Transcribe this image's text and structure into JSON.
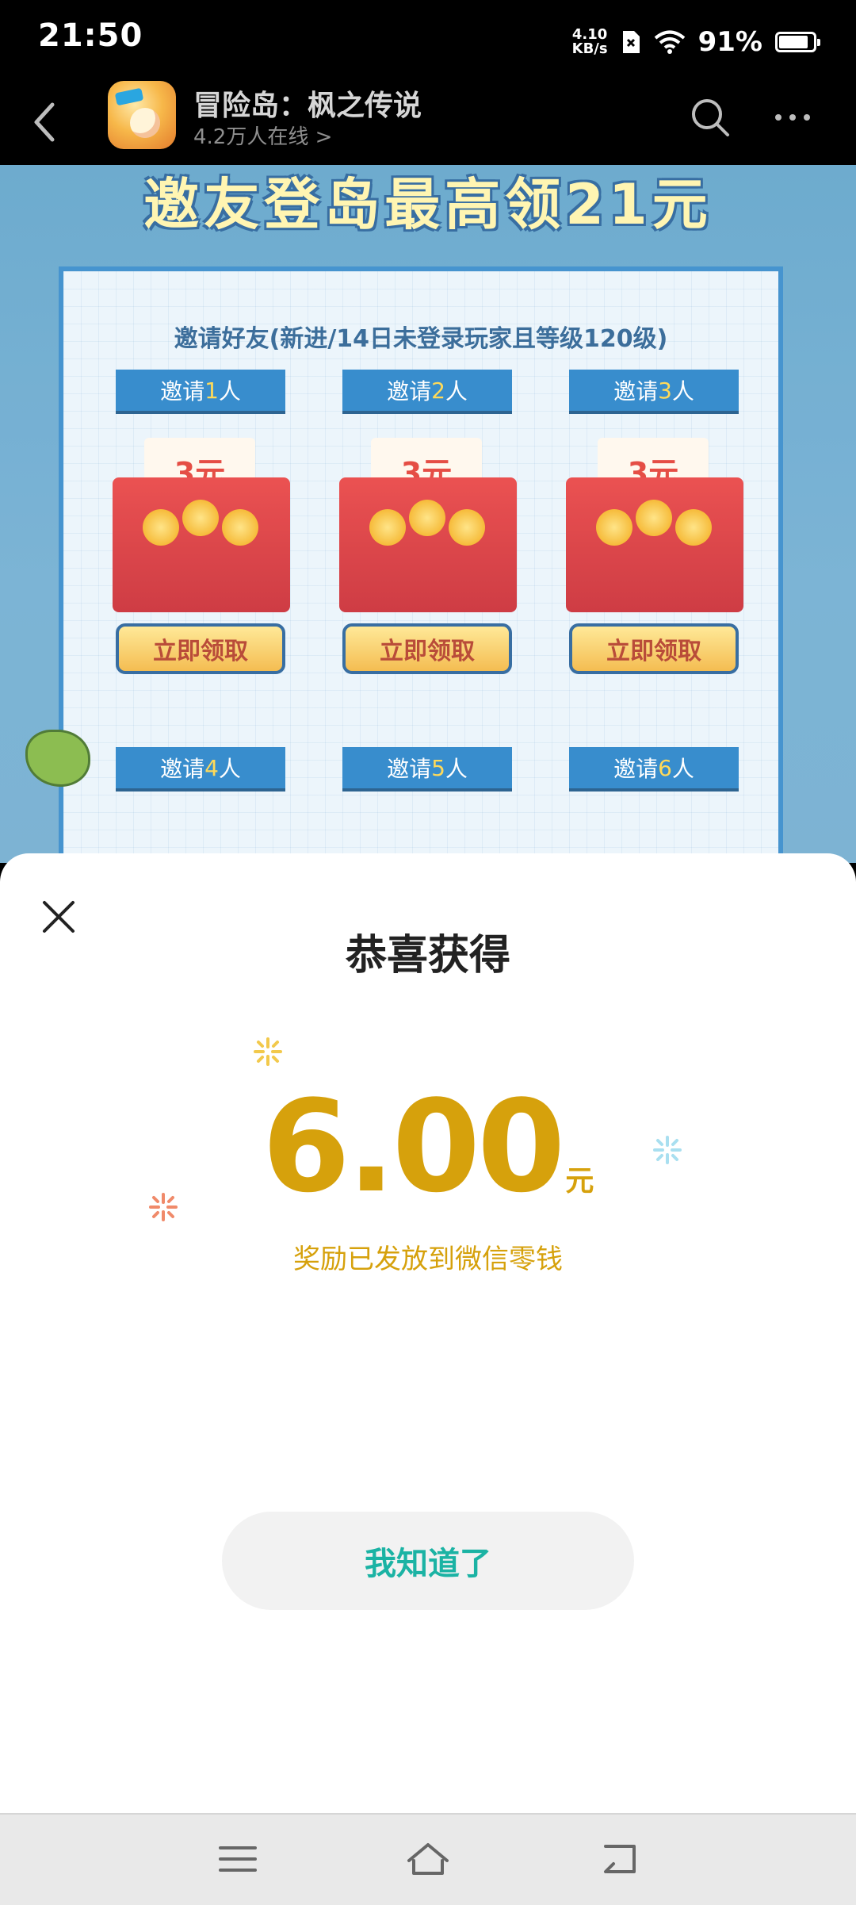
{
  "status_bar": {
    "time": "21:50",
    "net_speed_value": "4.10",
    "net_speed_unit": "KB/s",
    "battery_percent": "91%",
    "battery_level": 0.91
  },
  "nav": {
    "title": "冒险岛：枫之传说",
    "subtitle": "4.2万人在线 >"
  },
  "promo": {
    "banner": "邀友登岛最高领21元",
    "heading": "邀请好友(新进/14日未登录玩家且等级120级)",
    "invites": [
      {
        "pre": "邀请",
        "num": "1",
        "post": "人"
      },
      {
        "pre": "邀请",
        "num": "2",
        "post": "人"
      },
      {
        "pre": "邀请",
        "num": "3",
        "post": "人"
      },
      {
        "pre": "邀请",
        "num": "4",
        "post": "人"
      },
      {
        "pre": "邀请",
        "num": "5",
        "post": "人"
      },
      {
        "pre": "邀请",
        "num": "6",
        "post": "人"
      }
    ],
    "packet_amount": "3元",
    "claim_label": "立即领取"
  },
  "sheet": {
    "title": "恭喜获得",
    "amount": "6.00",
    "unit": "元",
    "desc": "奖励已发放到微信零钱",
    "ack_label": "我知道了"
  },
  "colors": {
    "gold": "#d6a10c",
    "teal": "#1bb3a4",
    "promo_blue": "#2d86c9"
  },
  "icons": {
    "back": "chevron-left-icon",
    "search": "search-icon",
    "more": "more-dots-icon",
    "close": "close-icon",
    "menu": "menu-icon",
    "home": "home-icon",
    "return": "return-icon"
  }
}
